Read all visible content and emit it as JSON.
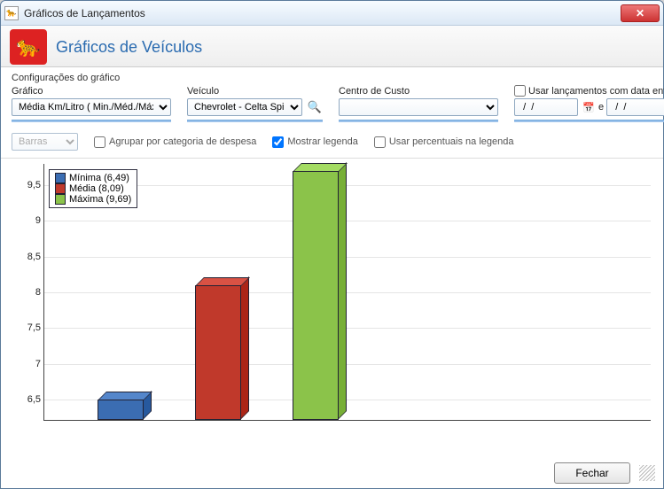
{
  "window": {
    "title": "Gráficos de Lançamentos"
  },
  "header": {
    "page_title": "Gráficos de Veículos"
  },
  "config": {
    "group_label": "Configurações do gráfico",
    "grafico_label": "Gráfico",
    "grafico_value": "Média Km/Litro ( Min./Méd./Máx. )",
    "veiculo_label": "Veículo",
    "veiculo_value": "Chevrolet - Celta Spirit Fl",
    "centro_label": "Centro de Custo",
    "centro_value": "",
    "usar_data_label": "Usar lançamentos com data entre",
    "date1": "  /  /",
    "date_sep": "e",
    "date2": "  /  /"
  },
  "options": {
    "tipo_value": "Barras",
    "agrupar_label": "Agrupar por categoria de despesa",
    "agrupar_checked": false,
    "mostrar_legenda_label": "Mostrar legenda",
    "mostrar_legenda_checked": true,
    "usar_percentuais_label": "Usar percentuais na legenda",
    "usar_percentuais_checked": false
  },
  "legend": {
    "items": [
      {
        "label": "Mínima (6,49)",
        "color": "#3b6db2"
      },
      {
        "label": "Média (8,09)",
        "color": "#c0392b"
      },
      {
        "label": "Máxima (9,69)",
        "color": "#8bc34a"
      }
    ]
  },
  "chart_data": {
    "type": "bar",
    "categories": [
      "Mínima",
      "Média",
      "Máxima"
    ],
    "values": [
      6.49,
      8.09,
      9.69
    ],
    "ylim": [
      6.2,
      9.8
    ],
    "yticks": [
      6.5,
      7,
      7.5,
      8,
      8.5,
      9,
      9.5
    ],
    "ytick_labels": [
      "6,5",
      "7",
      "7,5",
      "8",
      "8,5",
      "9",
      "9,5"
    ],
    "colors": [
      "#3b6db2",
      "#c0392b",
      "#8bc34a"
    ]
  },
  "footer": {
    "close_label": "Fechar"
  }
}
